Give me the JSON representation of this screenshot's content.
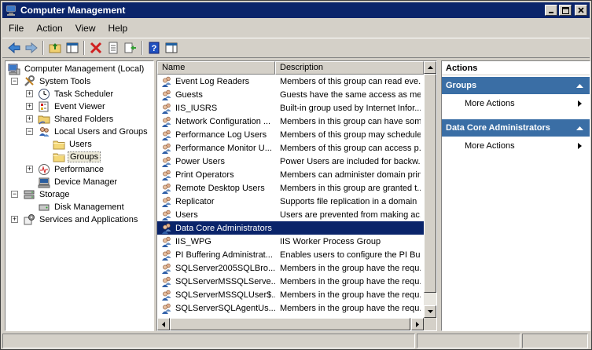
{
  "window": {
    "title": "Computer Management"
  },
  "menu": [
    "File",
    "Action",
    "View",
    "Help"
  ],
  "toolbar": [
    {
      "icon": "back-arrow-icon"
    },
    {
      "icon": "forward-arrow-icon"
    },
    {
      "icon": "up-folder-icon"
    },
    {
      "icon": "show-hide-tree-icon"
    },
    {
      "icon": "delete-icon"
    },
    {
      "icon": "properties-icon"
    },
    {
      "icon": "export-list-icon"
    },
    {
      "icon": "help-icon"
    },
    {
      "icon": "show-hide-action-pane-icon"
    }
  ],
  "tree": [
    {
      "label": "Computer Management (Local)",
      "level": 0,
      "expander": "",
      "icon": "computer-icon"
    },
    {
      "label": "System Tools",
      "level": 1,
      "expander": "−",
      "icon": "tools-icon"
    },
    {
      "label": "Task Scheduler",
      "level": 2,
      "expander": "+",
      "icon": "clock-icon"
    },
    {
      "label": "Event Viewer",
      "level": 2,
      "expander": "+",
      "icon": "event-viewer-icon"
    },
    {
      "label": "Shared Folders",
      "level": 2,
      "expander": "+",
      "icon": "shared-folder-icon"
    },
    {
      "label": "Local Users and Groups",
      "level": 2,
      "expander": "−",
      "icon": "users-icon"
    },
    {
      "label": "Users",
      "level": 3,
      "expander": "",
      "icon": "folder-icon"
    },
    {
      "label": "Groups",
      "level": 3,
      "expander": "",
      "icon": "folder-icon",
      "selected": true
    },
    {
      "label": "Performance",
      "level": 2,
      "expander": "+",
      "icon": "performance-icon"
    },
    {
      "label": "Device Manager",
      "level": 2,
      "expander": "",
      "icon": "device-manager-icon"
    },
    {
      "label": "Storage",
      "level": 1,
      "expander": "−",
      "icon": "storage-icon"
    },
    {
      "label": "Disk Management",
      "level": 2,
      "expander": "",
      "icon": "disk-icon"
    },
    {
      "label": "Services and Applications",
      "level": 1,
      "expander": "+",
      "icon": "services-icon"
    }
  ],
  "list": {
    "columns": [
      "Name",
      "Description"
    ],
    "rows": [
      {
        "name": "Event Log Readers",
        "description": "Members of this group can read eve..."
      },
      {
        "name": "Guests",
        "description": "Guests have the same access as me..."
      },
      {
        "name": "IIS_IUSRS",
        "description": "Built-in group used by Internet Infor..."
      },
      {
        "name": "Network Configuration ...",
        "description": "Members in this group can have som..."
      },
      {
        "name": "Performance Log Users",
        "description": "Members of this group may schedule..."
      },
      {
        "name": "Performance Monitor U...",
        "description": "Members of this group can access p..."
      },
      {
        "name": "Power Users",
        "description": "Power Users are included for backw..."
      },
      {
        "name": "Print Operators",
        "description": "Members can administer domain prin..."
      },
      {
        "name": "Remote Desktop Users",
        "description": "Members in this group are granted t..."
      },
      {
        "name": "Replicator",
        "description": "Supports file replication in a domain"
      },
      {
        "name": "Users",
        "description": "Users are prevented from making ac..."
      },
      {
        "name": "Data Core Administrators",
        "description": "",
        "selected": true
      },
      {
        "name": "IIS_WPG",
        "description": "IIS Worker Process Group"
      },
      {
        "name": "PI Buffering Administrat...",
        "description": "Enables users to configure the PI Bu..."
      },
      {
        "name": "SQLServer2005SQLBro...",
        "description": "Members in the group have the requ..."
      },
      {
        "name": "SQLServerMSSQLServe...",
        "description": "Members in the group have the requ..."
      },
      {
        "name": "SQLServerMSSQLUser$...",
        "description": "Members in the group have the requ..."
      },
      {
        "name": "SQLServerSQLAgentUs...",
        "description": "Members in the group have the requ..."
      }
    ]
  },
  "actions": {
    "title": "Actions",
    "sections": [
      {
        "header": "Groups",
        "items": [
          "More Actions"
        ]
      },
      {
        "header": "Data Core Administrators",
        "items": [
          "More Actions"
        ]
      }
    ]
  },
  "colors": {
    "selection": "#0a246a",
    "action_header": "#3a6ea5",
    "chrome": "#d4d0c8"
  }
}
